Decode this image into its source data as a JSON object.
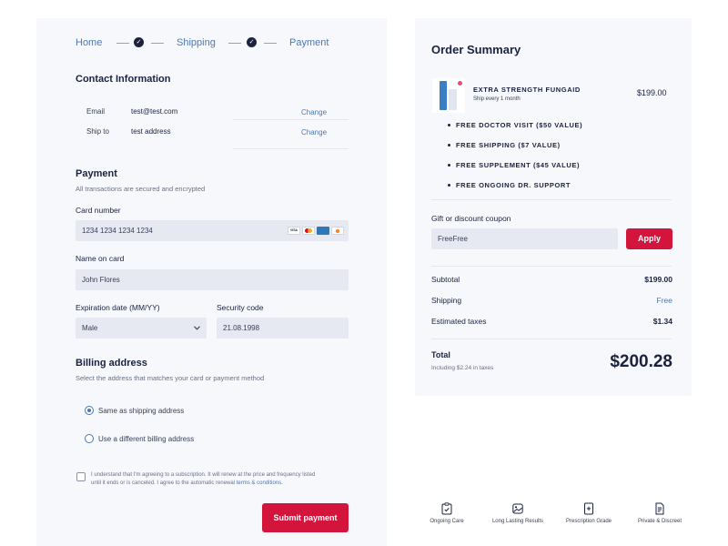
{
  "steps": {
    "home": "Home",
    "shipping": "Shipping",
    "payment": "Payment"
  },
  "contact": {
    "title": "Contact Information",
    "email_label": "Email",
    "email_value": "test@test.com",
    "ship_label": "Ship to",
    "ship_value": "test address",
    "change_label": "Change"
  },
  "payment": {
    "title": "Payment",
    "subtitle": "All transactions are secured and encrypted",
    "card_label": "Card number",
    "card_value": "1234 1234 1234 1234",
    "card_brands": [
      "VISA",
      "MC",
      "AMEX",
      "DISCOVER"
    ],
    "name_label": "Name on card",
    "name_value": "John Flores",
    "exp_label": "Expiration date (MM/YY)",
    "exp_value": "Male",
    "cvc_label": "Security code",
    "cvc_value": "21.08.1998"
  },
  "billing": {
    "title": "Billing address",
    "subtitle": "Select the address that matches your card or payment method",
    "option_same": "Same as shipping address",
    "option_different": "Use a different billing address"
  },
  "consent": {
    "line1": "I understand that I'm agreeing to a subscription. It will renew at the price and frequency listed",
    "line2": "until it ends or is canceled. I agree to the automatic renewal",
    "link": "terms & conditions."
  },
  "submit_label": "Submit payment",
  "summary": {
    "title": "Order Summary",
    "product_name": "EXTRA STRENGTH FUNGAID",
    "product_sub": "Ship every 1 month",
    "product_price": "$199.00",
    "perks": [
      "FREE DOCTOR VISIT ($50 VALUE)",
      "FREE SHIPPING ($7 VALUE)",
      "FREE SUPPLEMENT ($45 VALUE)",
      "FREE ONGOING DR. SUPPORT"
    ],
    "coupon_label": "Gift or discount coupon",
    "coupon_value": "FreeFree",
    "apply_label": "Apply",
    "subtotal_label": "Subtotal",
    "subtotal_value": "$199.00",
    "shipping_label": "Shipping",
    "shipping_value": "Free",
    "taxes_label": "Estimated taxes",
    "taxes_value": "$1.34",
    "total_label": "Total",
    "total_sub": "Including $2.24 in taxes",
    "total_value": "$200.28",
    "accent": "#d3143c",
    "link_color": "#4a78b5"
  },
  "features": [
    {
      "label": "Ongoing Care",
      "icon": "clipboard-icon"
    },
    {
      "label": "Long Lasting Results",
      "icon": "image-icon"
    },
    {
      "label": "Prescription Grade",
      "icon": "prescription-icon"
    },
    {
      "label": "Private & Discreet",
      "icon": "document-icon"
    }
  ]
}
